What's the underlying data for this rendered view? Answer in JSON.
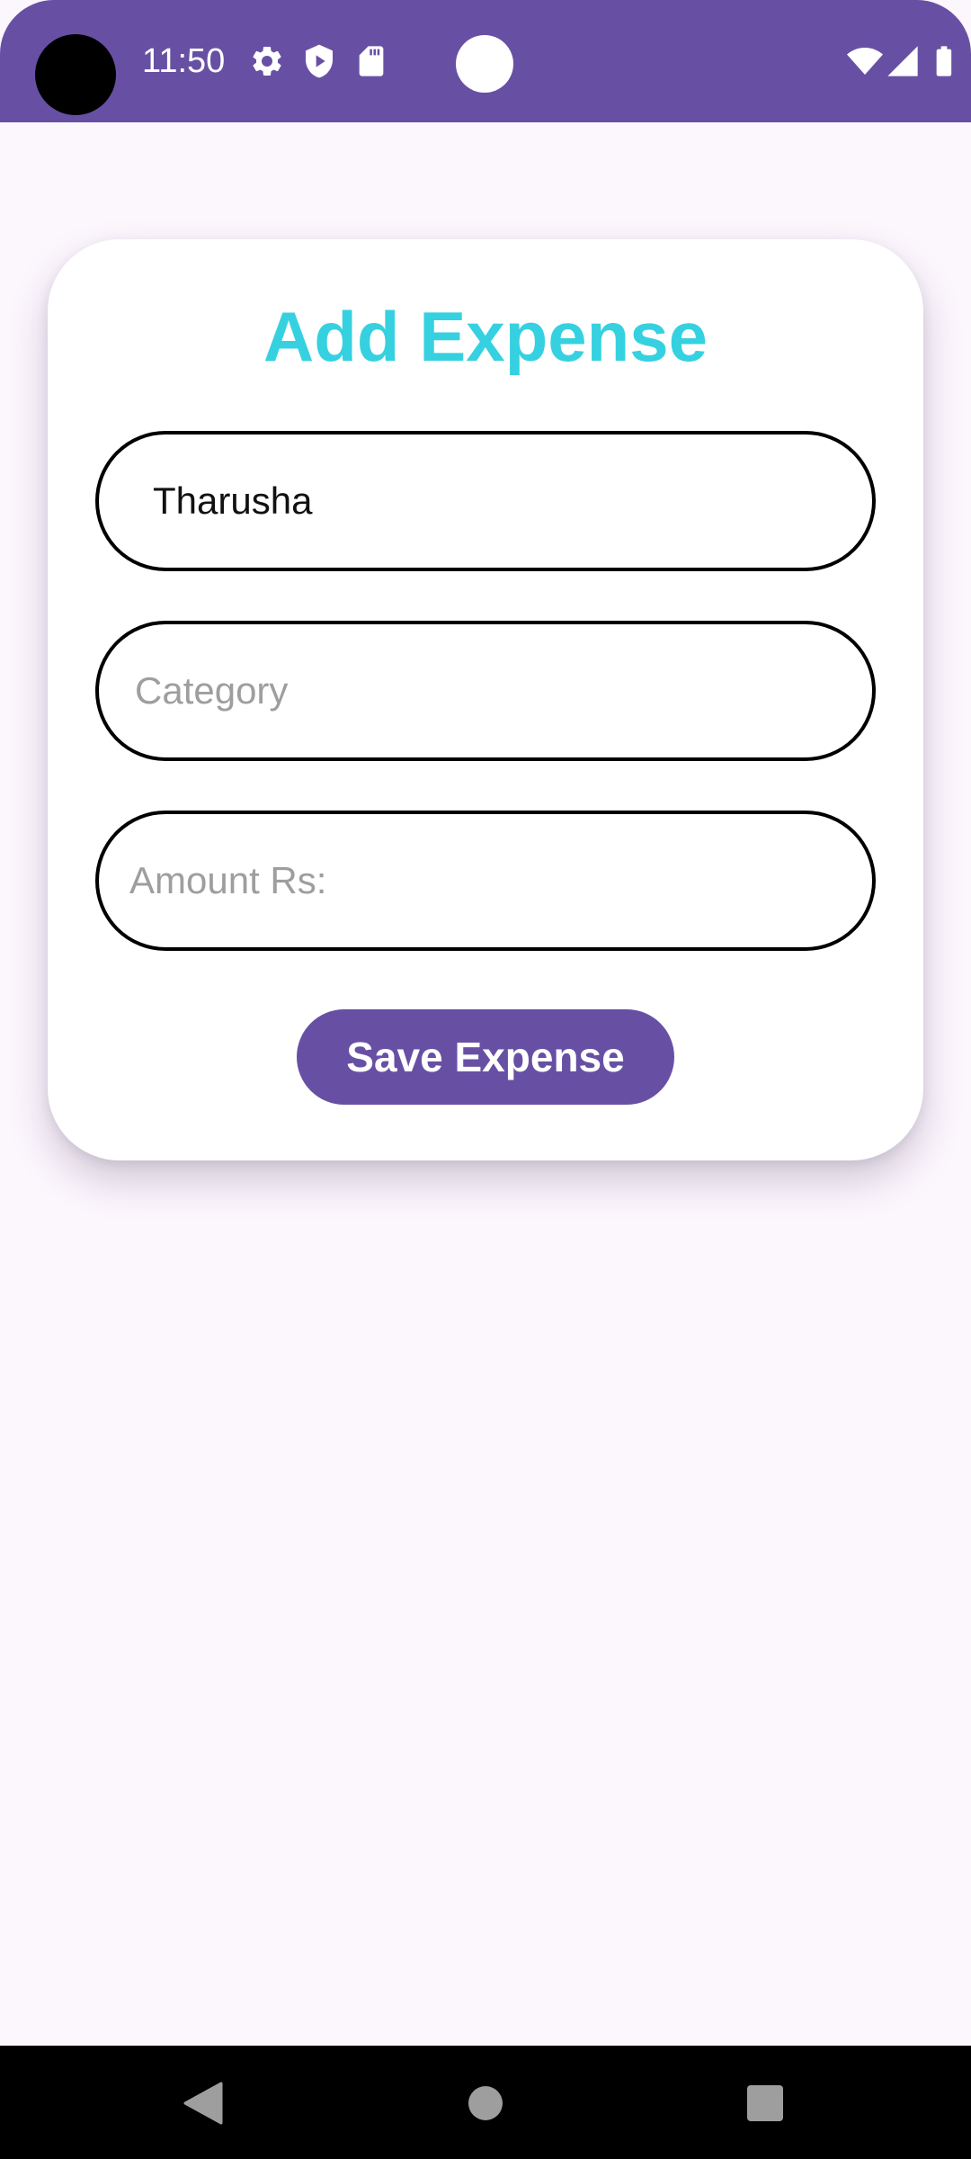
{
  "status_bar": {
    "time": "11:50",
    "icons": [
      "gear-icon",
      "shield-play-icon",
      "sd-card-icon",
      "wifi-icon",
      "signal-icon",
      "battery-icon"
    ],
    "background_color": "#6750a4"
  },
  "form": {
    "title": "Add Expense",
    "title_color": "#36d1e0",
    "fields": [
      {
        "name": "name",
        "value": "Tharusha",
        "placeholder": ""
      },
      {
        "name": "category",
        "value": "",
        "placeholder": "Category"
      },
      {
        "name": "amount",
        "value": "",
        "placeholder": "Amount Rs:"
      }
    ],
    "save_label": "Save Expense",
    "accent_color": "#6750a4"
  },
  "navigation": {
    "buttons": [
      "back-icon",
      "home-icon",
      "recents-icon"
    ]
  }
}
